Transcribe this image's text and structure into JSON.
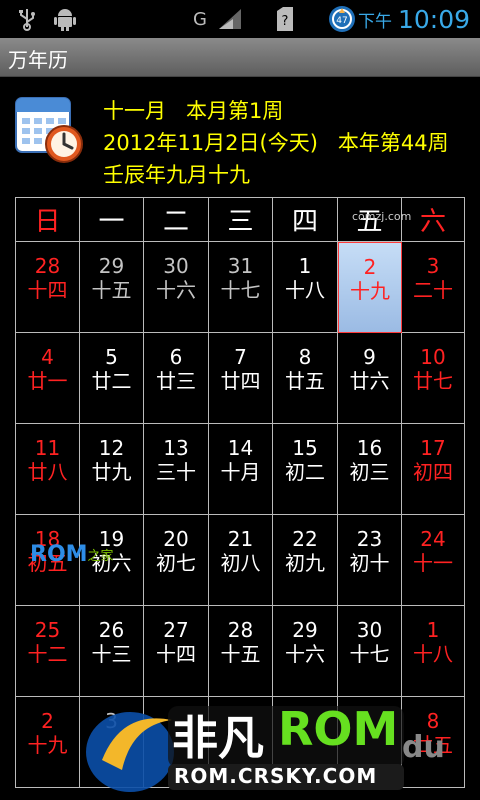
{
  "status_bar": {
    "network": "G",
    "ampm": "下午",
    "time": "10:09",
    "time_color": "#39a9e8"
  },
  "app": {
    "title": "万年历"
  },
  "header": {
    "line1": "十一月   本月第1周",
    "line2": "2012年11月2日(今天)   本年第44周",
    "line3": "壬辰年九月十九",
    "color": "#ffff00"
  },
  "weekdays": [
    "日",
    "一",
    "二",
    "三",
    "四",
    "五",
    "六"
  ],
  "weeks": [
    [
      {
        "day": "28",
        "lunar": "十四",
        "type": "other",
        "weekend": true
      },
      {
        "day": "29",
        "lunar": "十五",
        "type": "other"
      },
      {
        "day": "30",
        "lunar": "十六",
        "type": "other"
      },
      {
        "day": "31",
        "lunar": "十七",
        "type": "other"
      },
      {
        "day": "1",
        "lunar": "十八",
        "type": "current"
      },
      {
        "day": "2",
        "lunar": "十九",
        "type": "today"
      },
      {
        "day": "3",
        "lunar": "二十",
        "type": "current",
        "weekend": true
      }
    ],
    [
      {
        "day": "4",
        "lunar": "廿一",
        "type": "current",
        "weekend": true
      },
      {
        "day": "5",
        "lunar": "廿二",
        "type": "current"
      },
      {
        "day": "6",
        "lunar": "廿三",
        "type": "current"
      },
      {
        "day": "7",
        "lunar": "廿四",
        "type": "current"
      },
      {
        "day": "8",
        "lunar": "廿五",
        "type": "current"
      },
      {
        "day": "9",
        "lunar": "廿六",
        "type": "current"
      },
      {
        "day": "10",
        "lunar": "廿七",
        "type": "current",
        "weekend": true
      }
    ],
    [
      {
        "day": "11",
        "lunar": "廿八",
        "type": "current",
        "weekend": true
      },
      {
        "day": "12",
        "lunar": "廿九",
        "type": "current"
      },
      {
        "day": "13",
        "lunar": "三十",
        "type": "current"
      },
      {
        "day": "14",
        "lunar": "十月",
        "type": "current"
      },
      {
        "day": "15",
        "lunar": "初二",
        "type": "current"
      },
      {
        "day": "16",
        "lunar": "初三",
        "type": "current"
      },
      {
        "day": "17",
        "lunar": "初四",
        "type": "current",
        "weekend": true
      }
    ],
    [
      {
        "day": "18",
        "lunar": "初五",
        "type": "current",
        "weekend": true
      },
      {
        "day": "19",
        "lunar": "初六",
        "type": "current"
      },
      {
        "day": "20",
        "lunar": "初七",
        "type": "current"
      },
      {
        "day": "21",
        "lunar": "初八",
        "type": "current"
      },
      {
        "day": "22",
        "lunar": "初九",
        "type": "current"
      },
      {
        "day": "23",
        "lunar": "初十",
        "type": "current"
      },
      {
        "day": "24",
        "lunar": "十一",
        "type": "current",
        "weekend": true
      }
    ],
    [
      {
        "day": "25",
        "lunar": "十二",
        "type": "current",
        "weekend": true
      },
      {
        "day": "26",
        "lunar": "十三",
        "type": "current"
      },
      {
        "day": "27",
        "lunar": "十四",
        "type": "current"
      },
      {
        "day": "28",
        "lunar": "十五",
        "type": "current"
      },
      {
        "day": "29",
        "lunar": "十六",
        "type": "current"
      },
      {
        "day": "30",
        "lunar": "十七",
        "type": "current"
      },
      {
        "day": "1",
        "lunar": "十八",
        "type": "other",
        "weekend": true
      }
    ],
    [
      {
        "day": "2",
        "lunar": "十九",
        "type": "other",
        "weekend": true
      },
      {
        "day": "3",
        "lunar": "",
        "type": "other"
      },
      {
        "day": "",
        "lunar": "",
        "type": "other"
      },
      {
        "day": "",
        "lunar": "",
        "type": "other"
      },
      {
        "day": "",
        "lunar": "",
        "type": "other"
      },
      {
        "day": "",
        "lunar": "",
        "type": "other"
      },
      {
        "day": "8",
        "lunar": "廿五",
        "type": "other",
        "weekend": true
      }
    ]
  ],
  "colors": {
    "weekend": "#ff2222",
    "other_month": "#c4c4c4",
    "today_bg": "#b4cfee",
    "grid_line": "#bbbbbb"
  },
  "watermarks": {
    "rom_small": "ROM",
    "rom_small_suffix": "之家",
    "zmzj": "comzj.com",
    "feifan": "非凡",
    "feifan_rom": "ROM",
    "feifan_url": "ROM.CRSKY.COM",
    "baidu": "du"
  }
}
